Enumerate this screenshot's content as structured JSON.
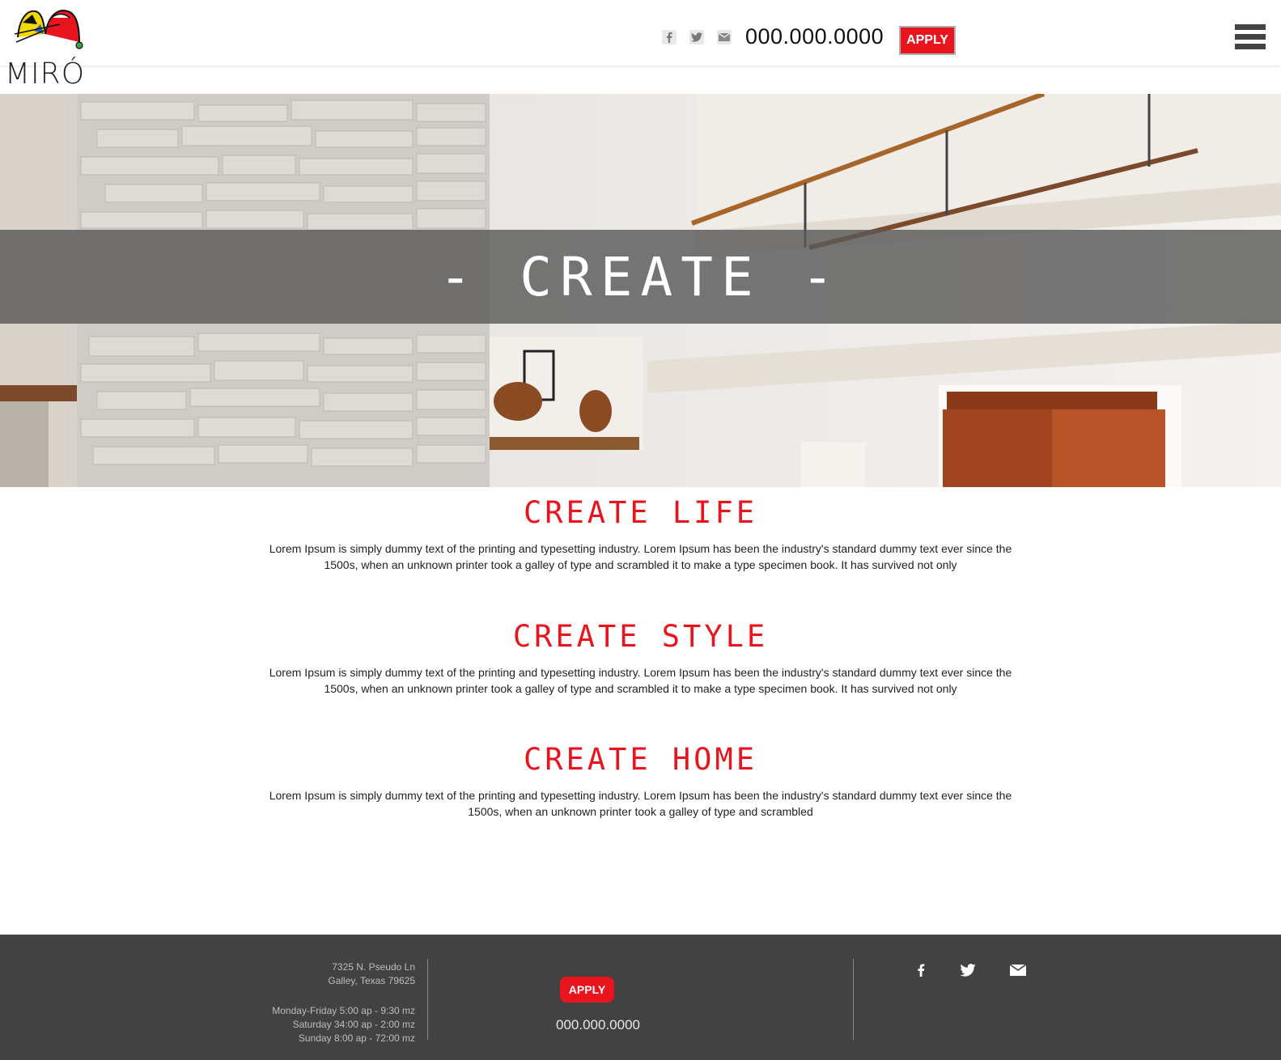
{
  "brand": {
    "name": "MIRÓ"
  },
  "header": {
    "social": [
      {
        "icon": "facebook-icon"
      },
      {
        "icon": "twitter-icon"
      },
      {
        "icon": "mail-icon"
      }
    ],
    "phone": "000.000.0000",
    "apply_label": "APPLY",
    "menu_icon": "hamburger-menu-icon"
  },
  "hero": {
    "title": "- CREATE -"
  },
  "sections": [
    {
      "title": "CREATE LIFE",
      "body": "Lorem Ipsum is simply dummy text of the printing and typesetting industry. Lorem Ipsum has been the industry's standard dummy text ever since the 1500s, when an unknown printer took a galley of type and scrambled it to make a type specimen book. It has survived not only"
    },
    {
      "title": "CREATE STYLE",
      "body": "Lorem Ipsum is simply dummy text of the printing and typesetting industry. Lorem Ipsum has been the industry's standard dummy text ever since the 1500s, when an unknown printer took a galley of type and scrambled it to make a type specimen book. It has survived not only"
    },
    {
      "title": "CREATE HOME",
      "body": "Lorem Ipsum is simply dummy text of the printing and typesetting industry. Lorem Ipsum has been the industry's standard dummy text ever since the 1500s, when an unknown printer took a galley of type and scrambled"
    }
  ],
  "footer": {
    "address_line1": "7325 N. Pseudo Ln",
    "address_line2": "Galley, Texas 79625",
    "hours": [
      "Monday-Friday 5:00 ap - 9:30 mz",
      "Saturday 34:00 ap - 2:00 mz",
      "Sunday 8:00 ap - 72:00 mz"
    ],
    "apply_label": "APPLY",
    "phone": "000.000.0000",
    "social": [
      {
        "icon": "facebook-icon"
      },
      {
        "icon": "twitter-icon"
      },
      {
        "icon": "mail-icon"
      }
    ]
  },
  "colors": {
    "accent": "#e8151f",
    "footer_bg": "#424242",
    "band": "#5a5a5a"
  }
}
